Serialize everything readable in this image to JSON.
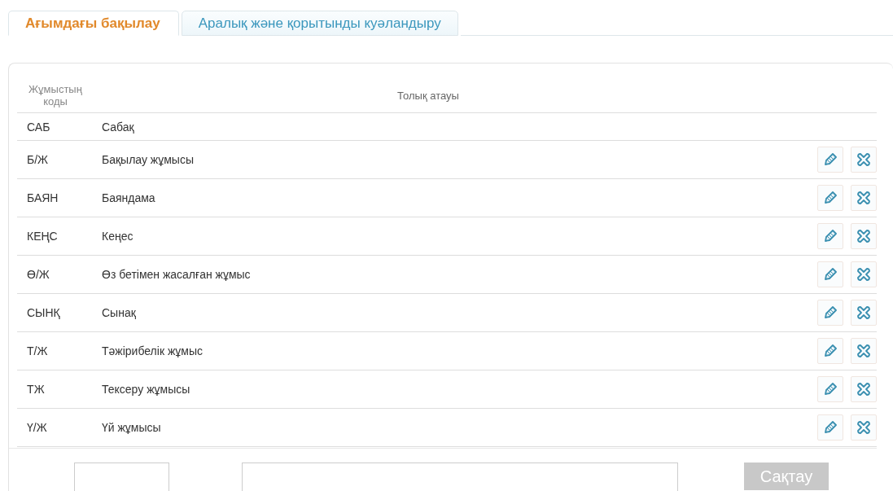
{
  "tabs": [
    {
      "label": "Ағымдағы бақылау",
      "selected": true
    },
    {
      "label": "Аралық және қорытынды куәландыру",
      "selected": false
    }
  ],
  "table": {
    "columns": [
      "Жұмыстың коды",
      "Толық атауы"
    ],
    "rows": [
      {
        "code": "САБ",
        "name": "Сабақ",
        "actions": false
      },
      {
        "code": "Б/Ж",
        "name": "Бақылау жұмысы",
        "actions": true
      },
      {
        "code": "БАЯН",
        "name": "Баяндама",
        "actions": true
      },
      {
        "code": "КЕҢС",
        "name": "Кеңес",
        "actions": true
      },
      {
        "code": "Ө/Ж",
        "name": "Өз бетімен жасалған жұмыс",
        "actions": true
      },
      {
        "code": "СЫНҚ",
        "name": "Сынақ",
        "actions": true
      },
      {
        "code": "Т/Ж",
        "name": "Тәжірибелік жұмыс",
        "actions": true
      },
      {
        "code": "ТЖ",
        "name": "Тексеру жұмысы",
        "actions": true
      },
      {
        "code": "Ү/Ж",
        "name": "Үй жұмысы",
        "actions": true
      }
    ]
  },
  "form": {
    "save_button": {
      "label": "Сақтау",
      "disabled": true
    }
  }
}
